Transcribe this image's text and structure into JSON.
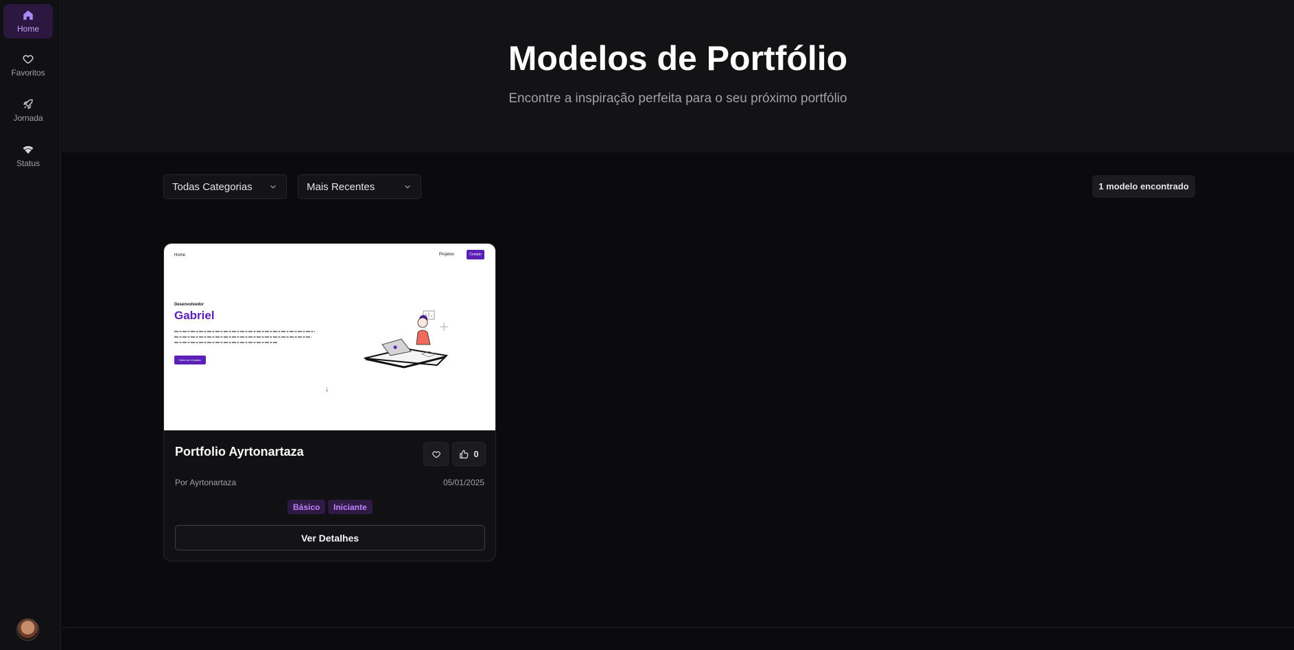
{
  "sidebar": {
    "items": [
      {
        "label": "Home",
        "icon": "home-icon"
      },
      {
        "label": "Favoritos",
        "icon": "heart-icon"
      },
      {
        "label": "Jornada",
        "icon": "rocket-icon"
      },
      {
        "label": "Status",
        "icon": "wifi-icon"
      }
    ],
    "active": "Home"
  },
  "hero": {
    "title": "Modelos de Portfólio",
    "subtitle": "Encontre a inspiração perfeita para o seu próximo portfólio"
  },
  "filters": {
    "category": "Todas Categorias",
    "sort": "Mais Recentes",
    "result_count": "1 modelo encontrado"
  },
  "card": {
    "title": "Portfolio Ayrtonartaza",
    "likes": "0",
    "author": "Por Ayrtonartaza",
    "date": "05/01/2025",
    "tags": [
      "Básico",
      "Iniciante"
    ],
    "details_label": "Ver Detalhes",
    "preview": {
      "nav_home": "Home",
      "nav_projects": "Projetos",
      "nav_contact": "Contato",
      "role": "Desenvolvedor",
      "name": "Gabriel",
      "cta": "Entre em Contato"
    }
  },
  "colors": {
    "accent": "#5b21b6",
    "active_nav_bg": "#2b1740",
    "tag_bg": "#2e1a45",
    "tag_text": "#c084fc"
  }
}
